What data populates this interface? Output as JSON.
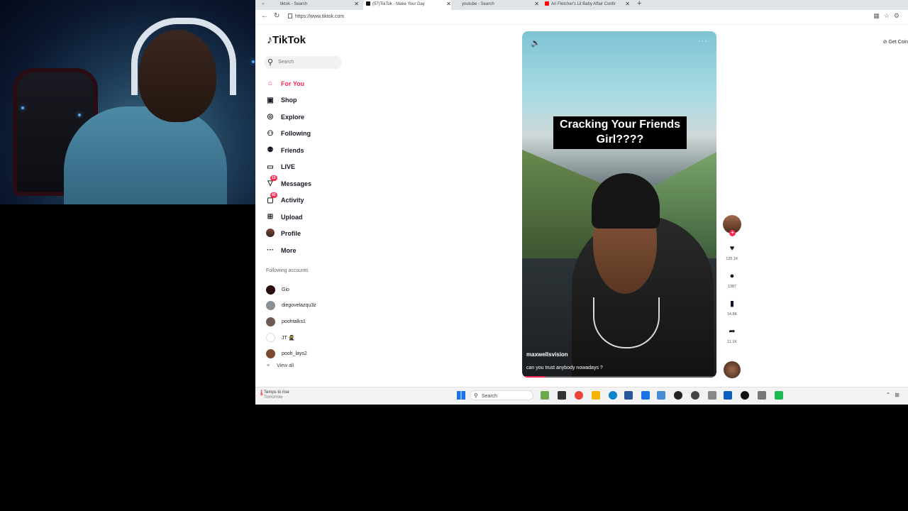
{
  "browser": {
    "tabs": [
      {
        "label": "tiktok - Search",
        "icon_color": "#1a73e8",
        "active": false
      },
      {
        "label": "(57)TikTok - Make Your Day",
        "icon_color": "#111111",
        "active": true
      },
      {
        "label": "youtube - Search",
        "icon_color": "#1a73e8",
        "active": false
      },
      {
        "label": "Ari Fletcher's Lil Baby Affair Confir",
        "icon_color": "#ff0000",
        "active": false
      }
    ],
    "url": "https://www.tiktok.com"
  },
  "tiktok": {
    "logo": "TikTok",
    "search_placeholder": "Search",
    "nav": [
      {
        "icon": "home-icon",
        "glyph": "⌂",
        "label": "For You",
        "active": true
      },
      {
        "icon": "shop-icon",
        "glyph": "🛍",
        "label": "Shop"
      },
      {
        "icon": "explore-icon",
        "glyph": "◎",
        "label": "Explore"
      },
      {
        "icon": "following-icon",
        "glyph": "⚇",
        "label": "Following"
      },
      {
        "icon": "friends-icon",
        "glyph": "⚇",
        "label": "Friends"
      },
      {
        "icon": "live-icon",
        "glyph": "▭",
        "label": "LIVE"
      },
      {
        "icon": "messages-icon",
        "glyph": "▽",
        "label": "Messages",
        "badge": "15"
      },
      {
        "icon": "activity-icon",
        "glyph": "▢",
        "label": "Activity",
        "badge": "42"
      },
      {
        "icon": "upload-icon",
        "glyph": "⊞",
        "label": "Upload"
      },
      {
        "icon": "profile-avatar",
        "glyph": "",
        "label": "Profile"
      },
      {
        "icon": "more-icon",
        "glyph": "···",
        "label": "More"
      }
    ],
    "following_title": "Following accounts",
    "following": [
      {
        "name": "Gio",
        "color": "#2a0e0e"
      },
      {
        "name": "diegovelazqu3z",
        "color": "#8a8f96"
      },
      {
        "name": "poohtalks1",
        "color": "#6e5a55"
      },
      {
        "name": "JT 🥷",
        "color": "#ffffff"
      },
      {
        "name": "pooh_lays2",
        "color": "#7a4a30"
      }
    ],
    "view_all": "View all",
    "get_coins": "Get Coin"
  },
  "video": {
    "caption": "Cracking Your Friends Girl????",
    "author": "maxwellsvision",
    "description": "can you trust anybody nowadays ?",
    "progress": 0.12,
    "actions": [
      {
        "name": "like",
        "icon": "heart-icon",
        "glyph": "♥",
        "count": "125.1K"
      },
      {
        "name": "comment",
        "icon": "comment-icon",
        "glyph": "●",
        "count": "1387"
      },
      {
        "name": "bookmark",
        "icon": "bookmark-icon",
        "glyph": "▮",
        "count": "14.8K"
      },
      {
        "name": "share",
        "icon": "share-icon",
        "glyph": "➦",
        "count": "11.1K"
      }
    ]
  },
  "taskbar": {
    "weather_title": "Temps to rise",
    "weather_sub": "Tomorrow",
    "search_label": "Search"
  }
}
